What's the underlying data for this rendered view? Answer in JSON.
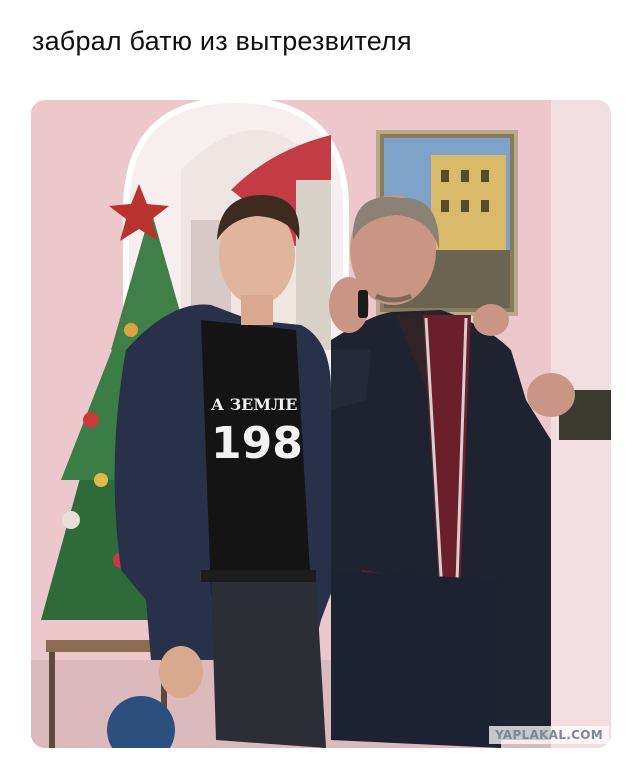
{
  "caption": "забрал батю из вытрезвителя",
  "photo": {
    "shirt_text_line1": "А ЗЕМЛЕ",
    "shirt_text_line2": "198",
    "watermark": "YAPLAKAL.COM"
  }
}
